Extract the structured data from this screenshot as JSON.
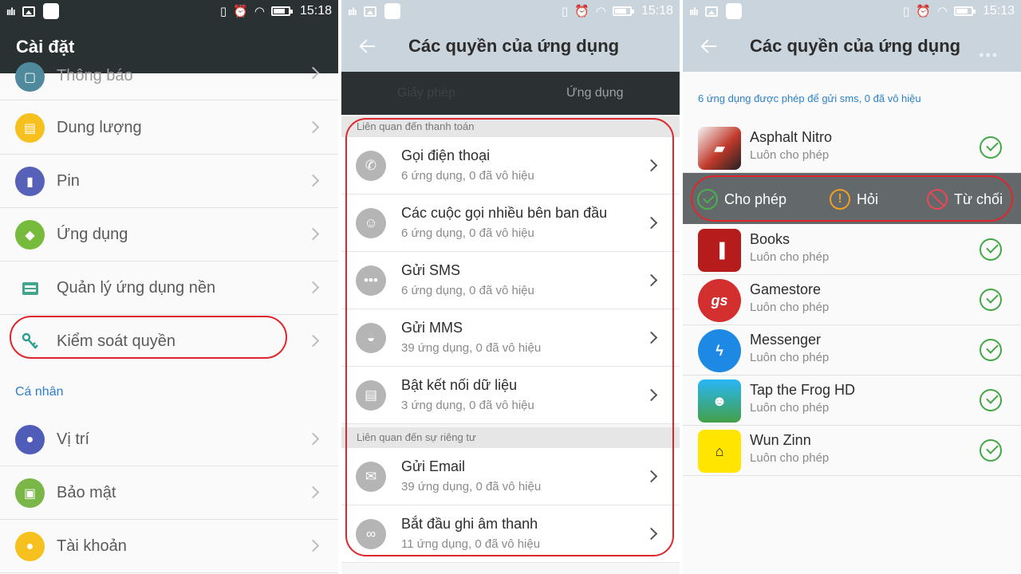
{
  "status": {
    "panel1_time": "15:18",
    "panel2_time": "15:18",
    "panel3_time": "15:13"
  },
  "settings": {
    "title": "Cài đặt",
    "items_top": [
      {
        "label": "Thông báo",
        "icon": "bell-icon",
        "color": "#4f8a9c"
      },
      {
        "label": "Dung lượng",
        "icon": "storage-icon",
        "color": "#f6c01e"
      },
      {
        "label": "Pin",
        "icon": "battery-icon",
        "color": "#5661b7"
      },
      {
        "label": "Ứng dụng",
        "icon": "android-icon",
        "color": "#76bb3b"
      },
      {
        "label": "Quản lý ứng dụng nền",
        "icon": "background-apps-icon",
        "color": "#44a58c"
      },
      {
        "label": "Kiểm soát quyền",
        "icon": "key-icon",
        "color": "#2a9d8f"
      }
    ],
    "section_personal": "Cá nhân",
    "items_personal": [
      {
        "label": "Vị trí",
        "icon": "location-icon",
        "color": "#4f5cb8"
      },
      {
        "label": "Bảo mật",
        "icon": "security-icon",
        "color": "#7ab648"
      },
      {
        "label": "Tài khoản",
        "icon": "account-icon",
        "color": "#f6c01e"
      }
    ]
  },
  "permissions": {
    "title": "Các quyền của ứng dụng",
    "tabs": [
      "Giấy phép",
      "Ứng dụng"
    ],
    "group_payment": "Liên quan đến thanh toán",
    "group_privacy": "Liên quan đến sự riêng tư",
    "payment_items": [
      {
        "title": "Gọi điện thoại",
        "sub": "6 ứng dụng, 0 đã vô hiệu",
        "icon": "phone-icon"
      },
      {
        "title": "Các cuộc gọi nhiều bên ban đầu",
        "sub": "6 ứng dụng, 0 đã vô hiệu",
        "icon": "conference-call-icon"
      },
      {
        "title": "Gửi SMS",
        "sub": "6 ứng dụng, 0 đã vô hiệu",
        "icon": "sms-icon"
      },
      {
        "title": "Gửi MMS",
        "sub": "39 ứng dụng, 0 đã vô hiệu",
        "icon": "mms-icon"
      },
      {
        "title": "Bật kết nối dữ liệu",
        "sub": "3 ứng dụng, 0 đã vô hiệu",
        "icon": "data-connection-icon"
      }
    ],
    "privacy_items": [
      {
        "title": "Gửi Email",
        "sub": "39 ứng dụng, 0 đã vô hiệu",
        "icon": "email-icon"
      },
      {
        "title": "Bắt đầu ghi âm thanh",
        "sub": "11 ứng dụng, 0 đã vô hiệu",
        "icon": "voicemail-icon"
      }
    ]
  },
  "app_permissions": {
    "title": "Các quyền của ứng dụng",
    "info": "6 ứng dụng được phép để gửi sms, 0 đã vô hiệu",
    "choices": [
      "Cho phép",
      "Hỏi",
      "Từ chối"
    ],
    "apps": [
      {
        "name": "Asphalt Nitro",
        "status": "Luôn cho phép",
        "icon": "asphalt-nitro-icon",
        "color": "#c0392b"
      },
      {
        "name": "Books",
        "status": "Luôn cho phép",
        "icon": "books-icon",
        "color": "#b71c1c"
      },
      {
        "name": "Gamestore",
        "status": "Luôn cho phép",
        "icon": "gamestore-icon",
        "color": "#d32f2f"
      },
      {
        "name": "Messenger",
        "status": "Luôn cho phép",
        "icon": "messenger-icon",
        "color": "#1e88e5"
      },
      {
        "name": "Tap the Frog HD",
        "status": "Luôn cho phép",
        "icon": "tap-the-frog-icon",
        "color": "#43a047"
      },
      {
        "name": "Wun Zinn",
        "status": "Luôn cho phép",
        "icon": "wun-zinn-icon",
        "color": "#ffe500"
      }
    ]
  }
}
